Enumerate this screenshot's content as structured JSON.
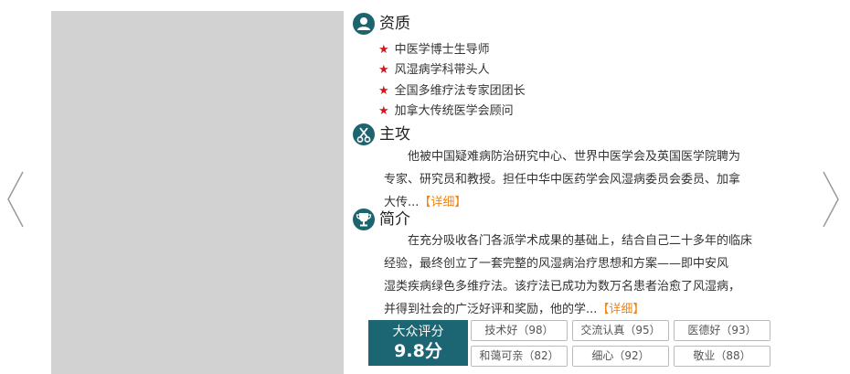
{
  "qualifications": {
    "title": "资质",
    "items": [
      "中医学博士生导师",
      "风湿病学科带头人",
      "全国多维疗法专家团团长",
      "加拿大传统医学会顾问"
    ]
  },
  "specialty": {
    "title": "主攻",
    "line1": "他被中国疑难病防治研究中心、世界中医学会及英国医学院聘为",
    "line2": "专家、研究员和教授。担任中华中医药学会风湿病委员会委员、加拿",
    "line3": "大传...",
    "more": "【详细】"
  },
  "intro": {
    "title": "简介",
    "line1": "在充分吸收各门各派学术成果的基础上，结合自己二十多年的临床",
    "line2": "经验，最终创立了一套完整的风湿病治疗思想和方案——即中安风",
    "line3": "湿类疾病绿色多维疗法。该疗法已成功为数万名患者治愈了风湿病，",
    "line4": "并得到社会的广泛好评和奖励，他的学...",
    "more": "【详细】"
  },
  "rating": {
    "label": "大众评分",
    "score": "9.8分",
    "tags": [
      "技术好（98）",
      "交流认真（95）",
      "医德好（93）",
      "和蔼可亲（82）",
      "细心（92）",
      "敬业（88）"
    ]
  },
  "colors": {
    "accent": "#1b6672",
    "star": "#d4161d",
    "link": "#f08519",
    "photo_placeholder": "#d2d2d2"
  },
  "icons": {
    "prev": "chevron-left-icon",
    "next": "chevron-right-icon",
    "qualifications": "user-icon",
    "specialty": "scissors-icon",
    "intro": "trophy-icon",
    "bullet": "star-icon"
  }
}
